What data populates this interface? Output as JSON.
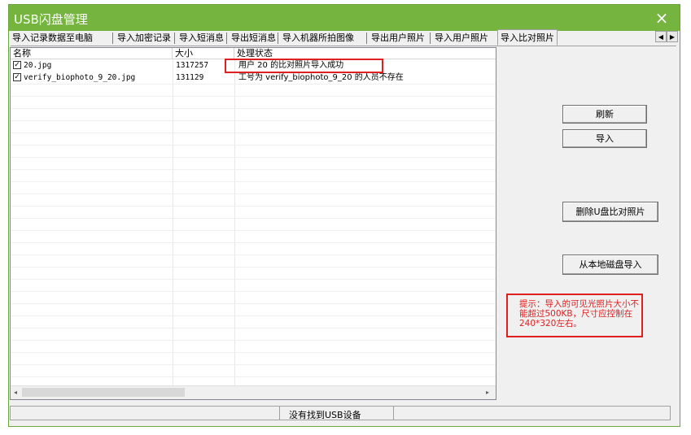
{
  "window": {
    "title": "USB闪盘管理",
    "close_glyph": "×"
  },
  "tabs": [
    {
      "label": "导入记录数据至电脑"
    },
    {
      "label": "导入加密记录"
    },
    {
      "label": "导入短消息"
    },
    {
      "label": "导出短消息"
    },
    {
      "label": "导入机器所拍图像"
    },
    {
      "label": "导出用户照片"
    },
    {
      "label": "导入用户照片"
    },
    {
      "label": "导入比对照片"
    }
  ],
  "tab_scroll": {
    "left": "◀",
    "right": "▶"
  },
  "list": {
    "columns": [
      "名称",
      "大小",
      "处理状态"
    ],
    "rows": [
      {
        "checked": "✓",
        "name": "20.jpg",
        "size": "1317257",
        "status": "用户 20 的比对照片导入成功"
      },
      {
        "checked": "✓",
        "name": "verify_biophoto_9_20.jpg",
        "size": "131129",
        "status": "工号为 verify_biophoto_9_20 的人员不存在"
      }
    ]
  },
  "scrollbar": {
    "left": "◂",
    "right": "▸"
  },
  "buttons": {
    "refresh": "刷新",
    "import": "导入",
    "delete_usb_photos": "删除U盘比对照片",
    "import_local_disk": "从本地磁盘导入"
  },
  "hint": {
    "text": "提示：导入的可见光照片大小不能超过500KB，尺寸应控制在240*320左右。"
  },
  "status": {
    "text": "没有找到USB设备"
  },
  "colors": {
    "title_bar": "#74b43f",
    "highlight_red": "#e02020"
  }
}
